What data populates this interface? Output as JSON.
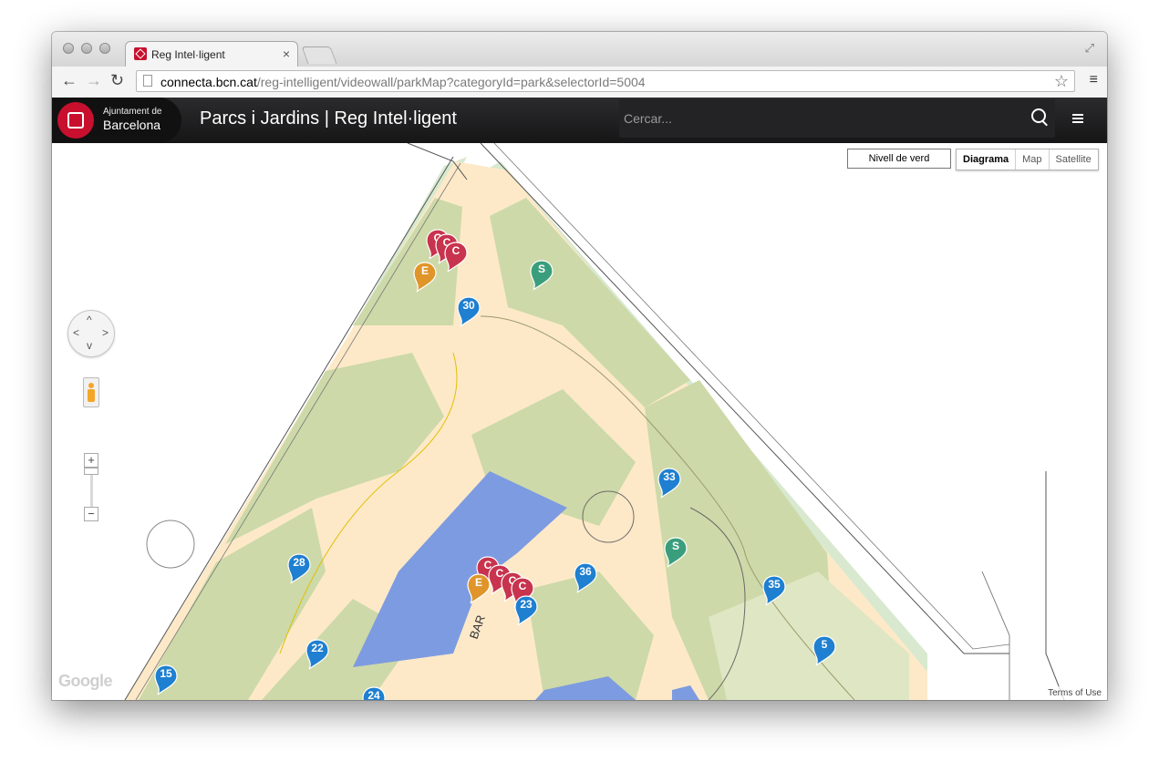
{
  "browser": {
    "tab_title": "Reg Intel·ligent",
    "tab_close": "×",
    "url_host": "connecta.bcn.cat",
    "url_path": "/reg-intelligent/videowall/parkMap?categoryId=park&selectorId=5004",
    "icons": [
      "back-arrow-icon",
      "forward-arrow-icon",
      "reload-icon",
      "page-icon",
      "star-icon",
      "menu-icon",
      "fullscreen-icon"
    ]
  },
  "header": {
    "logo_line1": "Ajuntament de",
    "logo_line2": "Barcelona",
    "title": "Parcs i Jardins | Reg Intel·ligent",
    "search_placeholder": "Cercar..."
  },
  "map": {
    "green_level_button": "Nivell de verd",
    "map_types": [
      "Diagrama",
      "Map",
      "Satellite"
    ],
    "selected_map_type": "Diagrama",
    "zoom_in": "+",
    "zoom_out": "−",
    "attribution": "Google",
    "terms": "Terms of Use",
    "colors": {
      "blue": "#1f7fd0",
      "red": "#c8334e",
      "orange": "#e0952a",
      "green": "#3a9e7c",
      "park": "#cdd9a8",
      "path": "#fde9c8",
      "building": "#7d9be0"
    },
    "markers": [
      {
        "label": "C",
        "color": "red"
      },
      {
        "label": "C",
        "color": "red"
      },
      {
        "label": "C",
        "color": "red"
      },
      {
        "label": "E",
        "color": "orange"
      },
      {
        "label": "S",
        "color": "green"
      },
      {
        "label": "30",
        "color": "blue"
      },
      {
        "label": "33",
        "color": "blue"
      },
      {
        "label": "S",
        "color": "green"
      },
      {
        "label": "28",
        "color": "blue"
      },
      {
        "label": "C",
        "color": "red"
      },
      {
        "label": "C",
        "color": "red"
      },
      {
        "label": "C",
        "color": "red"
      },
      {
        "label": "C",
        "color": "red"
      },
      {
        "label": "E",
        "color": "orange"
      },
      {
        "label": "23",
        "color": "blue"
      },
      {
        "label": "36",
        "color": "blue"
      },
      {
        "label": "35",
        "color": "blue"
      },
      {
        "label": "22",
        "color": "blue"
      },
      {
        "label": "5",
        "color": "blue"
      },
      {
        "label": "15",
        "color": "blue"
      },
      {
        "label": "24",
        "color": "blue"
      }
    ],
    "plan_labels": [
      "BAR"
    ]
  }
}
